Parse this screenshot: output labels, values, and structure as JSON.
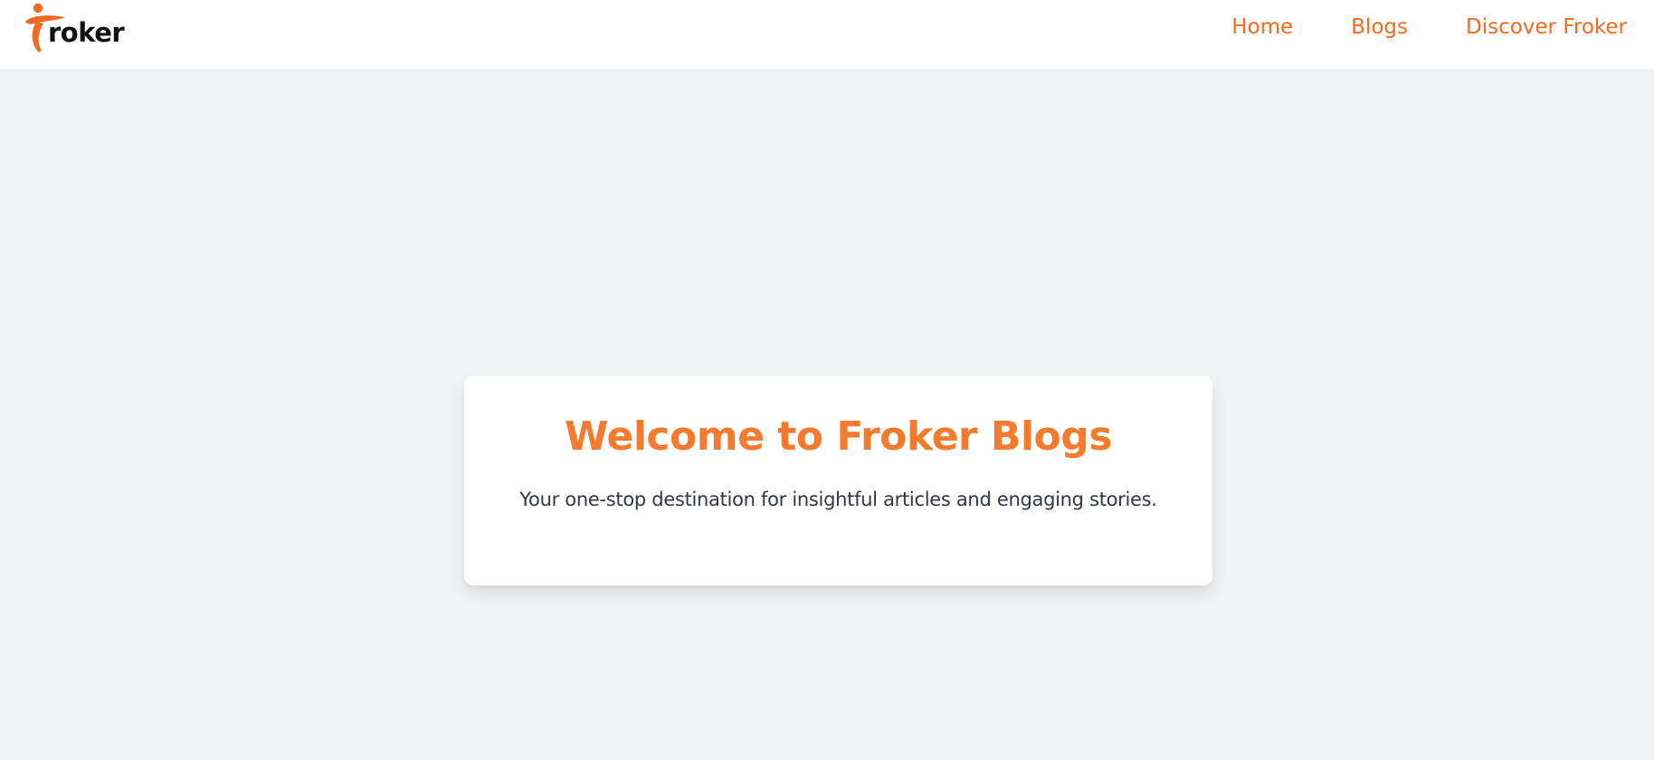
{
  "brand": {
    "logo_text": "roker",
    "logo_icon": "froker-figure-logo",
    "accent_color": "#f26a21"
  },
  "nav": {
    "items": [
      {
        "label": "Home"
      },
      {
        "label": "Blogs"
      },
      {
        "label": "Discover Froker"
      }
    ]
  },
  "hero": {
    "title": "Welcome to Froker Blogs",
    "subtitle": "Your one-stop destination for insightful articles and engaging stories."
  }
}
